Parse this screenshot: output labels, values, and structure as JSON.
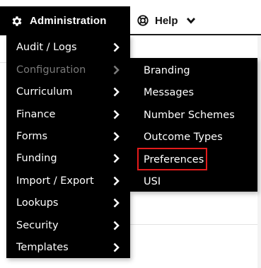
{
  "topnav": {
    "admin_label": "Administration",
    "admin_icon": "gear-icon",
    "help_label": "Help",
    "help_icon": "lifebuoy-icon",
    "help_chevron": "chevron-down-icon"
  },
  "menu": {
    "items": [
      {
        "label": "Audit / Logs",
        "disabled": false
      },
      {
        "label": "Configuration",
        "disabled": true
      },
      {
        "label": "Curriculum",
        "disabled": false
      },
      {
        "label": "Finance",
        "disabled": false
      },
      {
        "label": "Forms",
        "disabled": false
      },
      {
        "label": "Funding",
        "disabled": false
      },
      {
        "label": "Import / Export",
        "disabled": false
      },
      {
        "label": "Lookups",
        "disabled": false
      },
      {
        "label": "Security",
        "disabled": false
      },
      {
        "label": "Templates",
        "disabled": false
      }
    ]
  },
  "submenu": {
    "parent": "Configuration",
    "items": [
      {
        "label": "Branding"
      },
      {
        "label": "Messages"
      },
      {
        "label": "Number Schemes"
      },
      {
        "label": "Outcome Types"
      },
      {
        "label": "Preferences",
        "highlighted": true
      },
      {
        "label": "USI"
      }
    ]
  },
  "colors": {
    "menu_bg": "#000000",
    "menu_text": "#ffffff",
    "disabled_text": "#7a7a7a",
    "highlight_border": "#e31b1b"
  }
}
